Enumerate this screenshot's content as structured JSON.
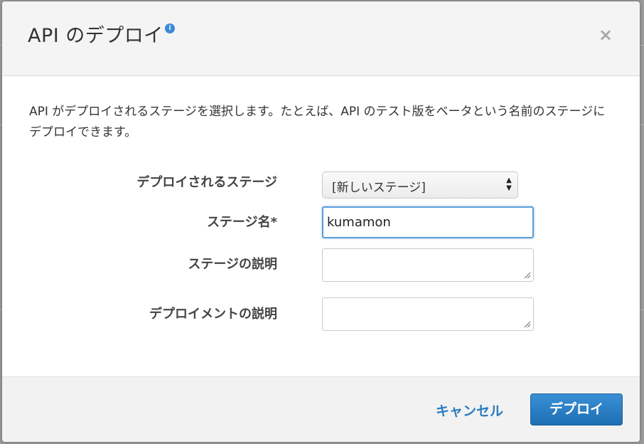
{
  "dialog": {
    "title": "API のデプロイ",
    "info_icon": "info-icon",
    "close_icon": "close-icon",
    "close_glyph": "×"
  },
  "body": {
    "description": "API がデプロイされるステージを選択します。たとえば、API のテスト版をベータという名前のステージにデプロイできます。"
  },
  "form": {
    "deploy_stage": {
      "label": "デプロイされるステージ",
      "selected": "[新しいステージ]"
    },
    "stage_name": {
      "label": "ステージ名*",
      "value": "kumamon"
    },
    "stage_description": {
      "label": "ステージの説明",
      "value": ""
    },
    "deployment_description": {
      "label": "デプロイメントの説明",
      "value": ""
    }
  },
  "footer": {
    "cancel_label": "キャンセル",
    "deploy_label": "デプロイ"
  },
  "colors": {
    "accent": "#2a7bc0",
    "primary_button": "#2477be",
    "focus_border": "#5b9dd9",
    "info_dot": "#3b8ad9"
  }
}
